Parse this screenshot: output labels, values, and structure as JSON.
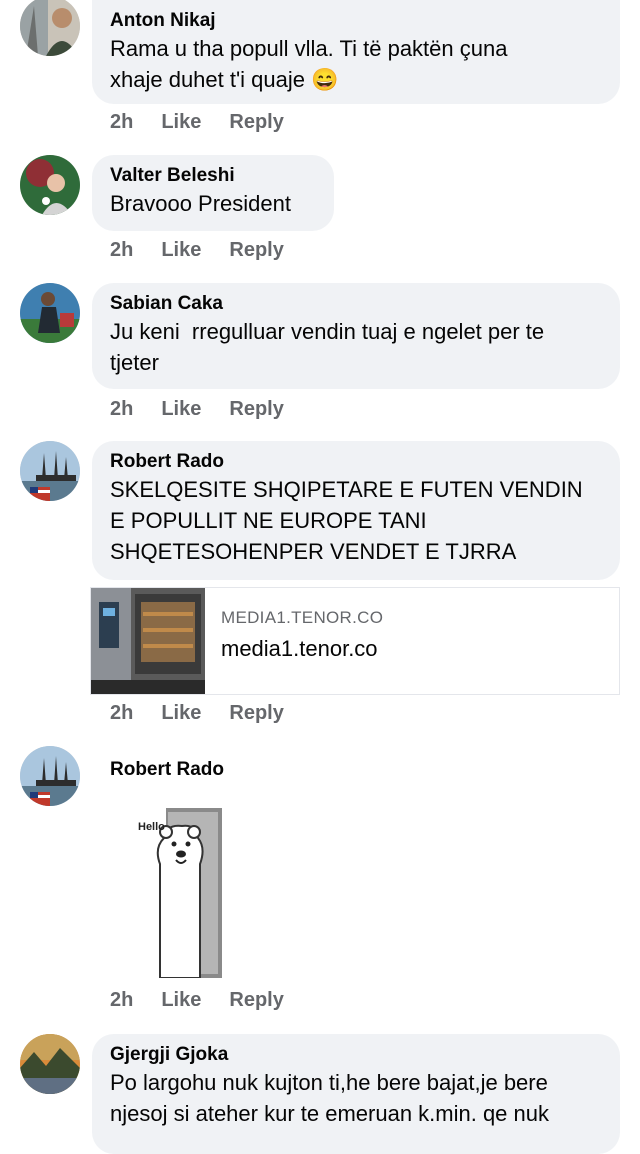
{
  "comments": [
    {
      "author": "Anton Nikaj",
      "text": "Rama u tha popull vlla. Ti të paktën çuna\nxhaje duhet t'i quaje 😄",
      "time": "2h",
      "like": "Like",
      "reply": "Reply"
    },
    {
      "author": "Valter Beleshi",
      "text": "Bravooo President",
      "time": "2h",
      "like": "Like",
      "reply": "Reply"
    },
    {
      "author": "Sabian Caka",
      "text": "Ju keni  rregulluar vendin tuaj e ngelet per te\ntjeter",
      "time": "2h",
      "like": "Like",
      "reply": "Reply"
    },
    {
      "author": "Robert Rado",
      "text": "SKELQESITE SHQIPETARE E FUTEN VENDIN\nE POPULLIT NE EUROPE TANI\nSHQETESOHENPER VENDET E TJRRA",
      "time": "2h",
      "like": "Like",
      "reply": "Reply",
      "link": {
        "domain": "MEDIA1.TENOR.CO",
        "title": "media1.tenor.co"
      }
    },
    {
      "author": "Robert Rado",
      "gif_text": "Hello",
      "time": "2h",
      "like": "Like",
      "reply": "Reply"
    },
    {
      "author": "Gjergji Gjoka",
      "text": "Po largohu nuk kujton ti,he bere bajat,je bere\nnjesoj si ateher kur te emeruan k.min. qe nuk"
    }
  ]
}
